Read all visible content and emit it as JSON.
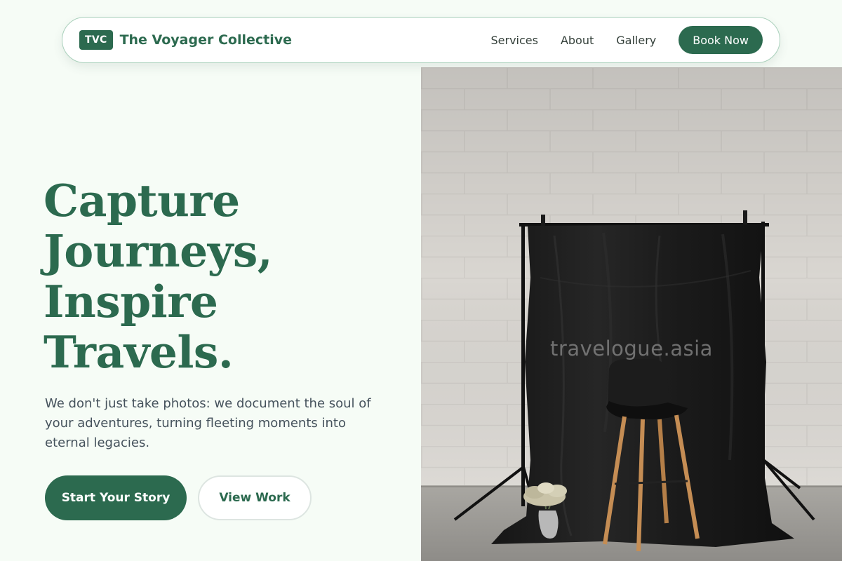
{
  "nav": {
    "logo_badge": "TVC",
    "logo_text": "The Voyager Collective",
    "links": [
      "Services",
      "About",
      "Gallery"
    ],
    "cta": "Book Now"
  },
  "hero": {
    "title_lines": [
      "Capture",
      "Journeys,",
      "Inspire",
      "Travels."
    ],
    "subtitle": "We don't just take photos: we document the soul of your adventures, turning fleeting moments into eternal legacies.",
    "primary_button": "Start Your Story",
    "secondary_button": "View Work"
  },
  "image": {
    "watermark": "travelogue.asia"
  },
  "colors": {
    "brand": "#2c6a4f",
    "page_background": "#f6fcf6",
    "body_text": "#45525c"
  }
}
